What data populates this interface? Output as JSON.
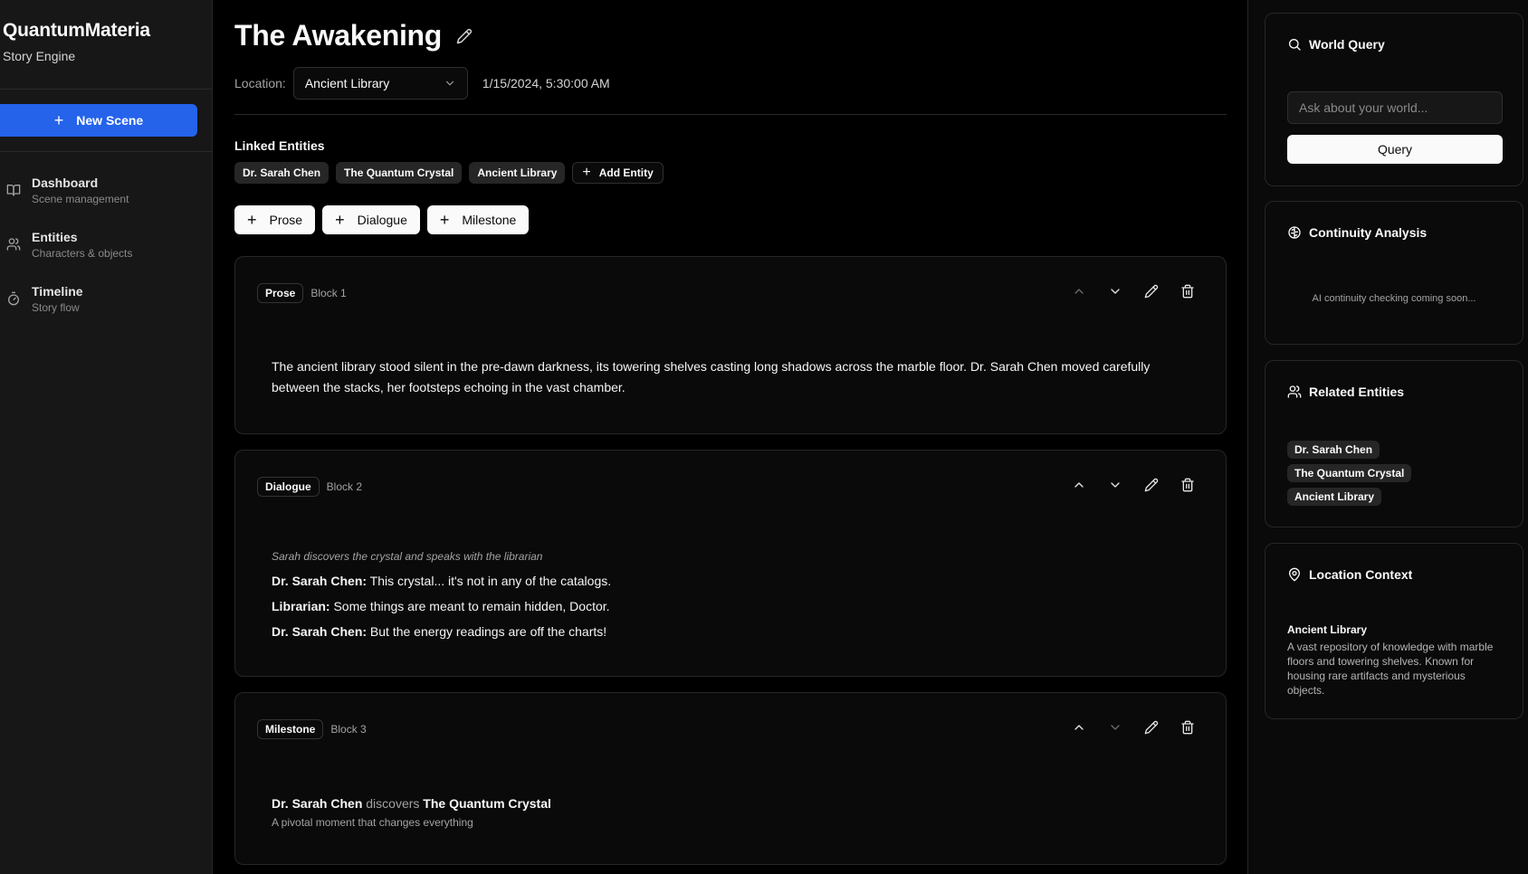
{
  "sidebar": {
    "brand_title": "QuantumMateria",
    "brand_sub": "Story Engine",
    "new_scene_label": "New Scene",
    "items": [
      {
        "label": "Dashboard",
        "sub": "Scene management",
        "icon": "book-open-icon"
      },
      {
        "label": "Entities",
        "sub": "Characters & objects",
        "icon": "users-icon"
      },
      {
        "label": "Timeline",
        "sub": "Story flow",
        "icon": "timer-icon"
      }
    ]
  },
  "scene": {
    "title": "The Awakening",
    "location_label": "Location:",
    "location_value": "Ancient Library",
    "timestamp": "1/15/2024, 5:30:00 AM",
    "linked_label": "Linked Entities",
    "linked_entities": [
      "Dr. Sarah Chen",
      "The Quantum Crystal",
      "Ancient Library"
    ],
    "add_entity_label": "Add Entity",
    "add_buttons": [
      "Prose",
      "Dialogue",
      "Milestone"
    ]
  },
  "blocks": [
    {
      "type": "Prose",
      "num": "Block 1",
      "text": "The ancient library stood silent in the pre-dawn darkness, its towering shelves casting long shadows across the marble floor. Dr. Sarah Chen moved carefully between the stacks, her footsteps echoing in the vast chamber."
    },
    {
      "type": "Dialogue",
      "num": "Block 2",
      "note": "Sarah discovers the crystal and speaks with the librarian",
      "lines": [
        {
          "speaker": "Dr. Sarah Chen:",
          "text": " This crystal... it's not in any of the catalogs."
        },
        {
          "speaker": "Librarian:",
          "text": " Some things are meant to remain hidden, Doctor."
        },
        {
          "speaker": "Dr. Sarah Chen:",
          "text": " But the energy readings are off the charts!"
        }
      ]
    },
    {
      "type": "Milestone",
      "num": "Block 3",
      "subject": "Dr. Sarah Chen",
      "verb": " discovers ",
      "object": "The Quantum Crystal",
      "sub": "A pivotal moment that changes everything"
    }
  ],
  "right": {
    "world_query": {
      "title": "World Query",
      "placeholder": "Ask about your world...",
      "button": "Query"
    },
    "continuity": {
      "title": "Continuity Analysis",
      "text": "AI continuity checking coming soon..."
    },
    "related": {
      "title": "Related Entities",
      "items": [
        "Dr. Sarah Chen",
        "The Quantum Crystal",
        "Ancient Library"
      ]
    },
    "location": {
      "title": "Location Context",
      "name": "Ancient Library",
      "desc": "A vast repository of knowledge with marble floors and towering shelves. Known for housing rare artifacts and mysterious objects."
    }
  },
  "colors": {
    "accent": "#2563eb",
    "background": "#000000",
    "panel": "#171717",
    "border": "#262626"
  }
}
